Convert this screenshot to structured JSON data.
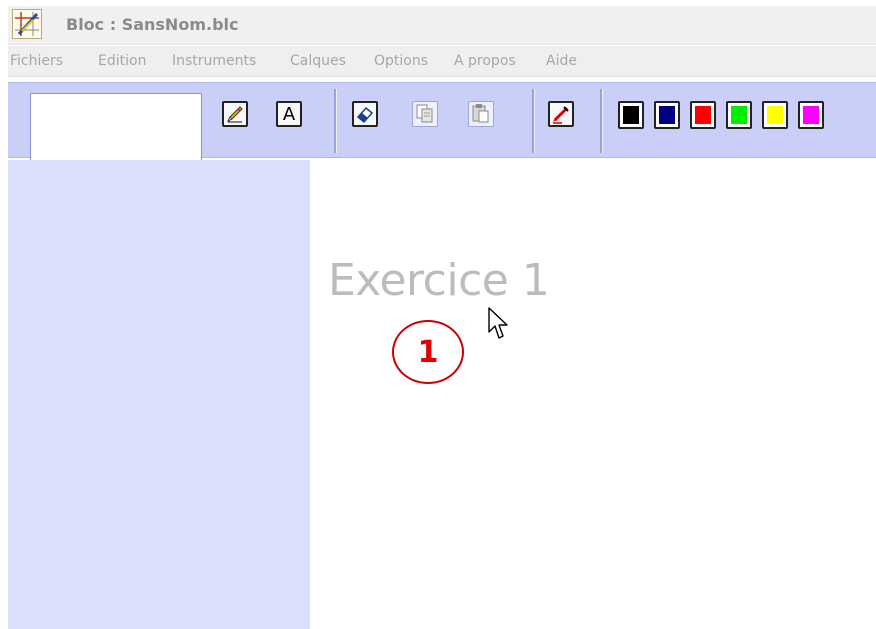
{
  "window": {
    "title": "Bloc : SansNom.blc",
    "app_icon": "bloc-app-icon"
  },
  "menu": {
    "items": [
      "Fichiers",
      "Edition",
      "Instruments",
      "Calques",
      "Options",
      "A propos",
      "Aide"
    ]
  },
  "toolbar": {
    "name_field_value": "",
    "tools": [
      {
        "icon": "pencil-icon"
      },
      {
        "icon": "text-tool-icon",
        "glyph": "A"
      },
      {
        "icon": "eraser-icon"
      },
      {
        "icon": "copy-icon"
      },
      {
        "icon": "paste-icon"
      },
      {
        "icon": "marker-icon"
      }
    ],
    "colors": [
      "#000000",
      "#000080",
      "#ff0000",
      "#00ee00",
      "#ffff00",
      "#ff00ff"
    ]
  },
  "canvas": {
    "exercise_title": "Exercice 1",
    "step_badge": "1"
  },
  "theme": {
    "toolbar_bg": "#c9cff7",
    "sidebar_bg": "#dcdffb",
    "badge_color": "#e00000"
  }
}
